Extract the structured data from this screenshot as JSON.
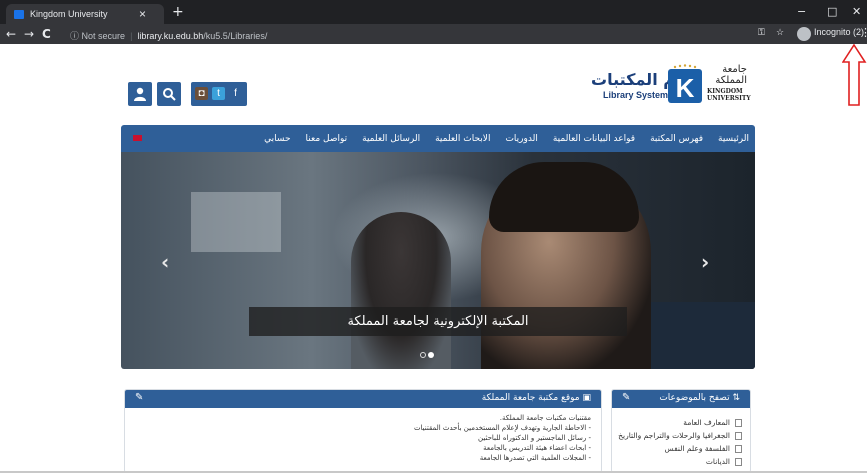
{
  "browser": {
    "tab_title": "Kingdom University",
    "tab_close": "×",
    "new_tab": "+",
    "security_label": "Not secure",
    "url_host": "library.ku.edu.bh",
    "url_path": "/ku5.5/Libraries/",
    "profile_label": "Incognito (2)",
    "back": "←",
    "forward": "→",
    "reload": "C",
    "minimize": "−",
    "maximize": "□",
    "close": "✕",
    "menu": "⋮",
    "key_icon": "key-icon",
    "star_icon": "star-icon"
  },
  "header": {
    "library_system_ar": "نظام المكتبات",
    "library_system_en": "Library System",
    "university_ar": "جامعة المملكة",
    "university_en_1": "KINGDOM",
    "university_en_2": "UNIVERSITY",
    "user_icon": "user-icon",
    "search_icon": "search-icon",
    "social": [
      "instagram-icon",
      "twitter-icon",
      "facebook-icon"
    ]
  },
  "nav": {
    "items": [
      "الرئيسية",
      "فهرس المكتبة",
      "قواعد البيانات العالمية",
      "الدوريات",
      "الابحاث العلمية",
      "الرسائل العلمية",
      "تواصل معنا",
      "حسابي"
    ],
    "language_flag": "uk-flag-icon"
  },
  "hero": {
    "caption": "المكتبة الإلكترونية لجامعة المملكة",
    "prev": "‹",
    "next": "›",
    "slides_count": 2,
    "active_slide": 2
  },
  "panels": {
    "library_site": {
      "title": "موقع مكتبة جامعة المملكة",
      "lines": [
        "مقتنيات مكتبات جامعة المملكة.",
        "- الاحاطة الجارية وتهدف لإعلام المستخدمين بأحدث المقتنيات",
        "- رسائل الماجستير و الدكتوراه للباحثين",
        "- ابحاث اعضاء هيئة التدريس بالجامعة",
        "- المجلات العلمية التي تصدرها الجامعة"
      ]
    },
    "browse_subjects": {
      "title": "تصفح بالموضوعات",
      "items": [
        "المعارف العامة",
        "الجغرافيا والرحلات والتراجم والتاريخ",
        "الفلسفة وعلم النفس",
        "الديانات"
      ]
    }
  },
  "colors": {
    "brand_blue": "#2f5f98",
    "chrome_dark": "#202124",
    "annotation_red": "#e02020"
  }
}
